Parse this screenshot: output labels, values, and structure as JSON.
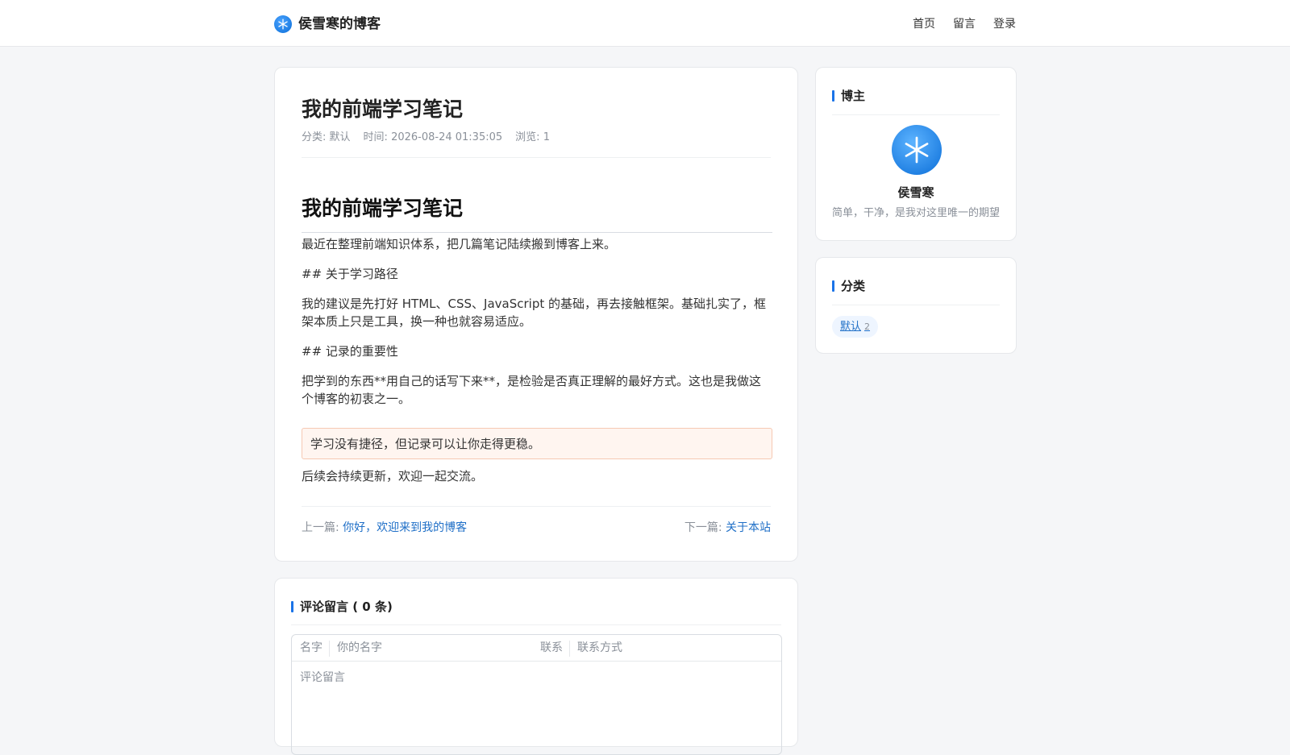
{
  "header": {
    "site_title": "侯雪寒的博客",
    "nav": [
      "首页",
      "留言",
      "登录"
    ]
  },
  "article": {
    "title": "我的前端学习笔记",
    "meta": {
      "category_label": "分类:",
      "category": "默认",
      "time_label": "时间:",
      "time": "2026-08-24 01:35:05",
      "views_label": "浏览:",
      "views": "1"
    },
    "content": {
      "heading": "我的前端学习笔记",
      "paragraphs": [
        "最近在整理前端知识体系，把几篇笔记陆续搬到博客上来。",
        "## 关于学习路径",
        "我的建议是先打好 HTML、CSS、JavaScript 的基础，再去接触框架。基础扎实了，框架本质上只是工具，换一种也就容易适应。",
        "## 记录的重要性",
        "把学到的东西**用自己的话写下来**，是检验是否真正理解的最好方式。这也是我做这个博客的初衷之一。",
        "后续会持续更新，欢迎一起交流。"
      ],
      "quote": "学习没有捷径，但记录可以让你走得更稳。"
    },
    "prev_label": "上一篇:",
    "prev_title": "你好，欢迎来到我的博客",
    "next_label": "下一篇:",
    "next_title": "关于本站"
  },
  "sidebar": {
    "blogger": {
      "heading": "博主",
      "name": "侯雪寒",
      "motto": "简单，干净，是我对这里唯一的期望"
    },
    "categories": {
      "heading": "分类",
      "items": [
        {
          "name": "默认",
          "count": "2"
        }
      ]
    }
  },
  "comments": {
    "heading": "评论留言 ( 0 条)",
    "name_label": "名字",
    "name_placeholder": "你的名字",
    "contact_label": "联系",
    "contact_placeholder": "联系方式",
    "comment_placeholder": "评论留言"
  },
  "colors": {
    "accent": "#1a73e8",
    "link": "#1f6fc7",
    "quote_bg": "#fff5f0",
    "quote_border": "#f6c9b3",
    "page_bg": "#f5f6f8"
  }
}
